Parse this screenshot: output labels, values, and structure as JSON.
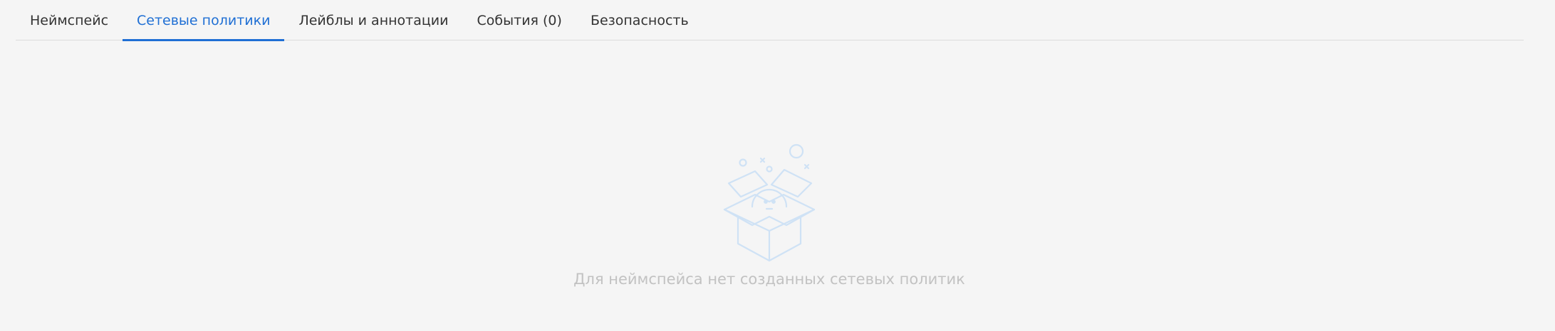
{
  "tabs": [
    {
      "label": "Неймспейс",
      "active": false
    },
    {
      "label": "Сетевые политики",
      "active": true
    },
    {
      "label": "Лейблы и аннотации",
      "active": false
    },
    {
      "label": "События (0)",
      "active": false
    },
    {
      "label": "Безопасность",
      "active": false
    }
  ],
  "empty_state": {
    "icon": "empty-box-icon",
    "message": "Для неймспейса нет созданных сетевых политик"
  },
  "colors": {
    "accent": "#1f6fd4",
    "background": "#f5f5f5",
    "illustration": "#cfe2f5",
    "muted_text": "#c2c2c2"
  }
}
